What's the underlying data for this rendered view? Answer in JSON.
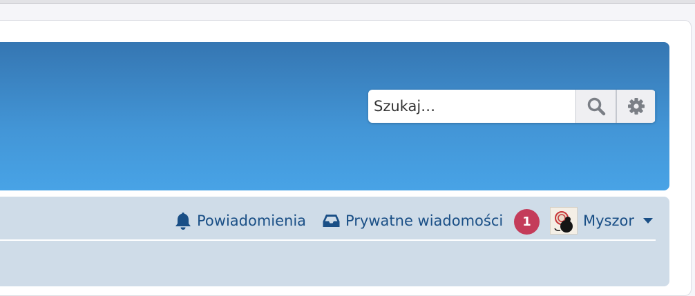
{
  "search": {
    "placeholder": "Szukaj…"
  },
  "nav": {
    "notifications_label": "Powiadomienia",
    "messages_label": "Prywatne wiadomości",
    "messages_count": "1",
    "username": "Myszor"
  },
  "colors": {
    "header_top": "#3576b2",
    "header_bottom": "#48a3e6",
    "navbar_bg": "#cfdce8",
    "link": "#1a4f86",
    "badge": "#c43c5a"
  },
  "icons": {
    "search": "search-icon",
    "settings": "gear-icon",
    "notifications": "bell-icon",
    "messages": "inbox-icon",
    "user_menu": "caret-down-icon"
  }
}
